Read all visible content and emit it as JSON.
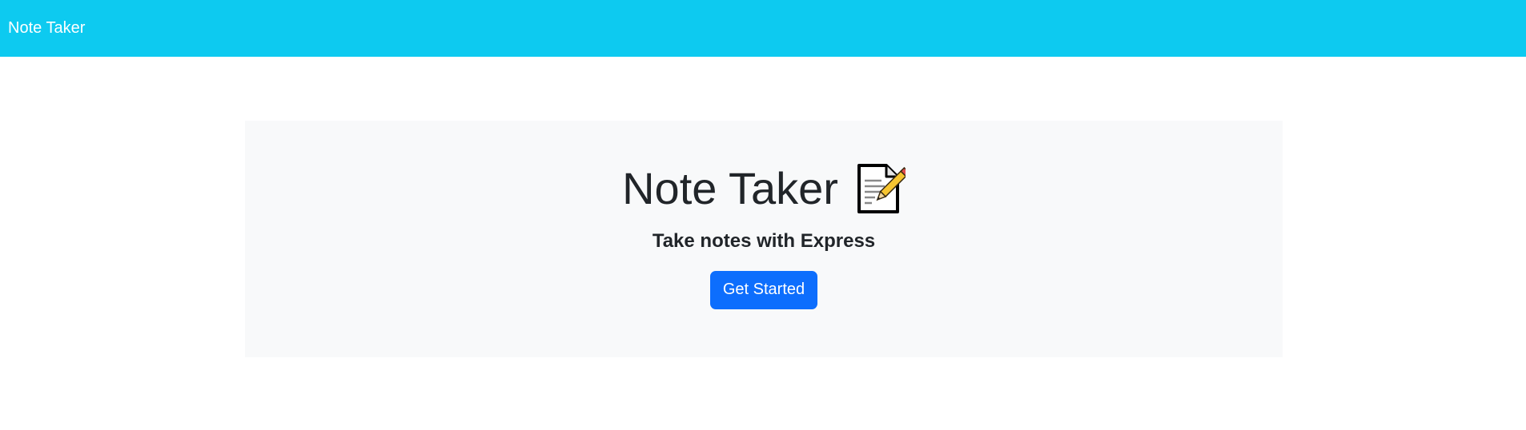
{
  "navbar": {
    "brand": "Note Taker",
    "background_color": "#0dcaf0"
  },
  "hero": {
    "title": "Note Taker",
    "title_icon": "memo-icon",
    "subtitle": "Take notes with Express",
    "button_label": "Get Started",
    "button_color": "#0d6efd",
    "background_color": "#f8f9fa"
  }
}
